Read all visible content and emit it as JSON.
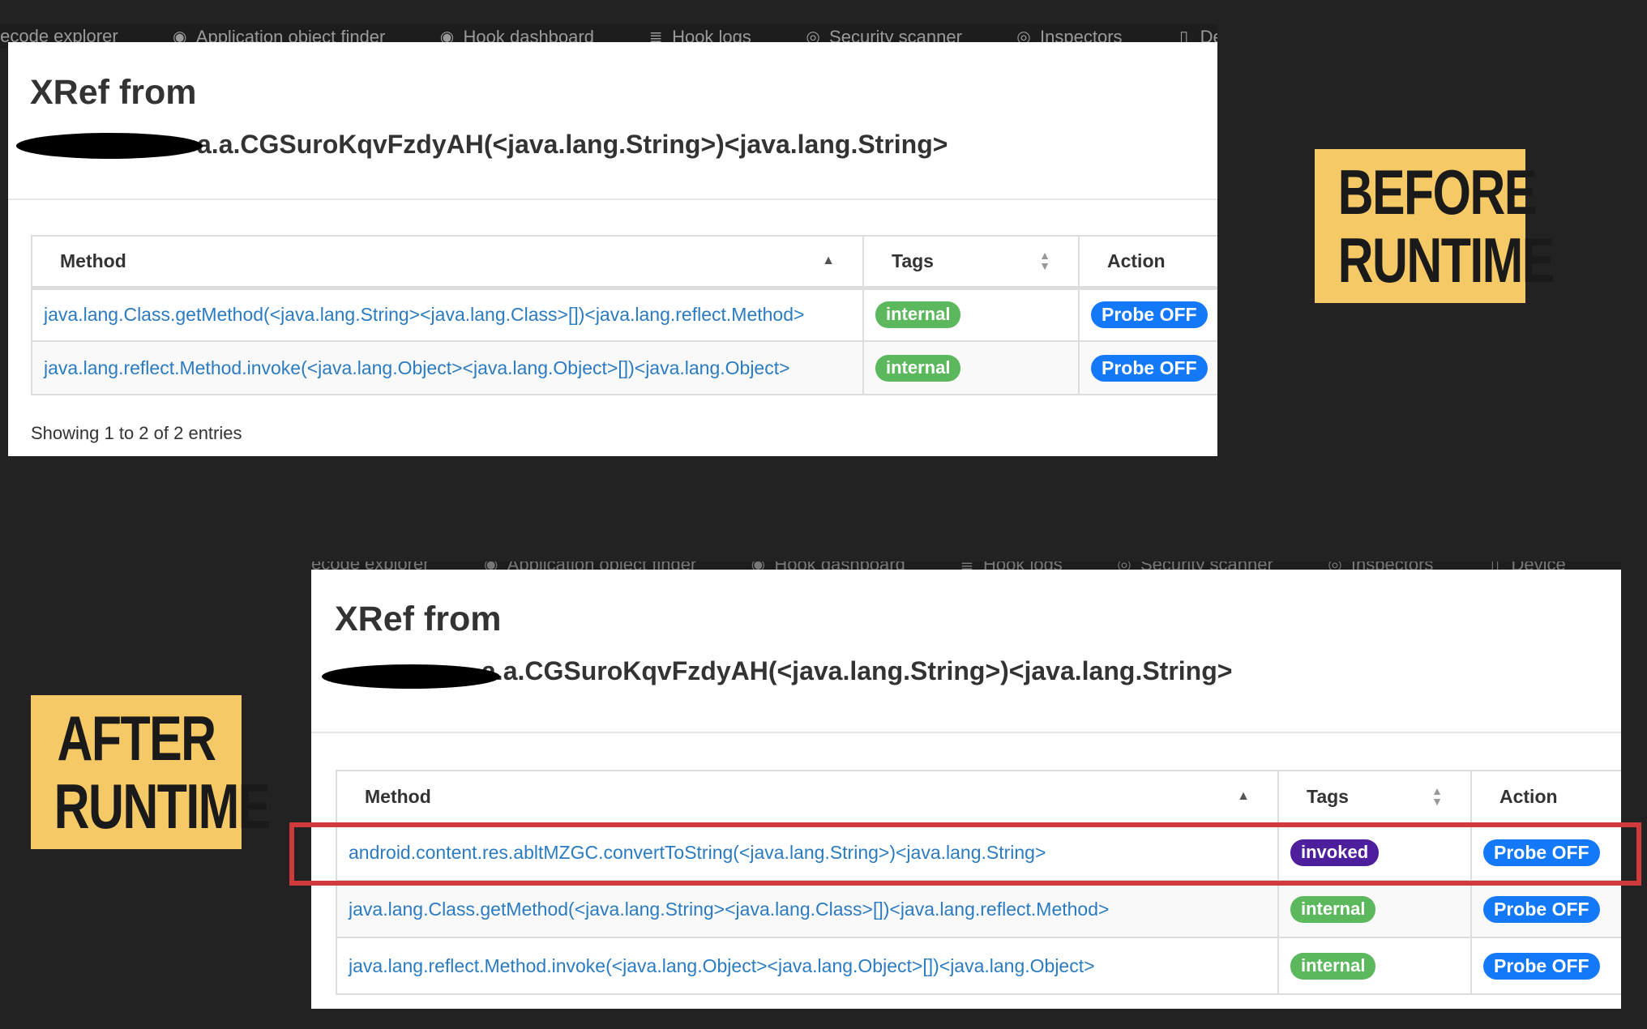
{
  "nav": {
    "items": [
      {
        "label": "tecode explorer",
        "icon": "code-icon"
      },
      {
        "label": "Application object finder",
        "icon": "eye-icon"
      },
      {
        "label": "Hook dashboard",
        "icon": "eye-icon"
      },
      {
        "label": "Hook logs",
        "icon": "database-icon"
      },
      {
        "label": "Security scanner",
        "icon": "target-icon"
      },
      {
        "label": "Inspectors",
        "icon": "compass-icon"
      },
      {
        "label": "De",
        "icon": "mobile-icon"
      }
    ],
    "after_items": [
      {
        "label": "ecode explorer",
        "icon": "code-icon"
      },
      {
        "label": "Application object finder",
        "icon": "eye-icon"
      },
      {
        "label": "Hook dashboard",
        "icon": "eye-icon"
      },
      {
        "label": "Hook logs",
        "icon": "database-icon"
      },
      {
        "label": "Security scanner",
        "icon": "target-icon"
      },
      {
        "label": "Inspectors",
        "icon": "compass-icon"
      },
      {
        "label": "Device",
        "icon": "mobile-icon"
      }
    ]
  },
  "before": {
    "title": "XRef from",
    "subtitle": "a.a.CGSuroKqvFzdyAH(<java.lang.String>)<java.lang.String>",
    "columns": {
      "method": "Method",
      "tags": "Tags",
      "action": "Action"
    },
    "rows": [
      {
        "method": "java.lang.Class.getMethod(<java.lang.String><java.lang.Class>[])<java.lang.reflect.Method>",
        "tag": "internal",
        "action": "Probe OFF"
      },
      {
        "method": "java.lang.reflect.Method.invoke(<java.lang.Object><java.lang.Object>[])<java.lang.Object>",
        "tag": "internal",
        "action": "Probe OFF"
      }
    ],
    "entries": "Showing 1 to 2 of 2 entries",
    "label_line1": "BEFORE",
    "label_line2": "RUNTIME"
  },
  "after": {
    "title": "XRef from",
    "subtitle": "a.a.CGSuroKqvFzdyAH(<java.lang.String>)<java.lang.String>",
    "columns": {
      "method": "Method",
      "tags": "Tags",
      "action": "Action"
    },
    "rows": [
      {
        "method": "android.content.res.abltMZGC.convertToString(<java.lang.String>)<java.lang.String>",
        "tag": "invoked",
        "action": "Probe OFF"
      },
      {
        "method": "java.lang.Class.getMethod(<java.lang.String><java.lang.Class>[])<java.lang.reflect.Method>",
        "tag": "internal",
        "action": "Probe OFF"
      },
      {
        "method": "java.lang.reflect.Method.invoke(<java.lang.Object><java.lang.Object>[])<java.lang.Object>",
        "tag": "internal",
        "action": "Probe OFF"
      }
    ],
    "label_line1": "AFTER",
    "label_line2": "RUNTIME"
  },
  "colors": {
    "background": "#222222",
    "label_bg": "#f5c966",
    "highlight": "#d03a3c",
    "tag_internal": "#5cb85c",
    "tag_invoked": "#4e1f9c",
    "probe_button": "#1479f8",
    "link": "#2b7bc1"
  }
}
